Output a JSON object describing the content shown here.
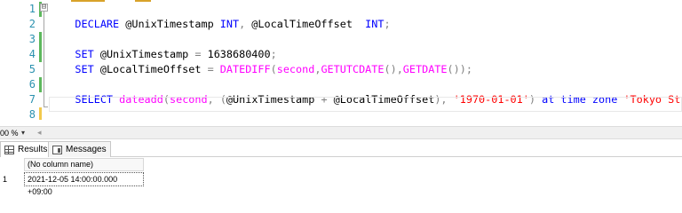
{
  "editor": {
    "line_numbers": [
      "1",
      "2",
      "3",
      "4",
      "5",
      "6",
      "7",
      "8"
    ],
    "fold_symbol": "⊟",
    "lines": {
      "l1": {
        "kw1": "DECLARE",
        "id1": " @UnixTimestamp ",
        "kw2": "INT",
        "op1": ",",
        "id2": " @LocalTimeOffset  ",
        "kw3": "INT",
        "op2": ";"
      },
      "l3": {
        "kw1": "SET",
        "id1": " @UnixTimestamp ",
        "op1": "=",
        "num": " 1638680400",
        "op2": ";"
      },
      "l4": {
        "kw1": "SET",
        "id1": " @LocalTimeOffset ",
        "op1": "=",
        "fn1": " DATEDIFF",
        "op2": "(",
        "kw2": "second",
        "op3": ",",
        "fn2": "GETUTCDATE",
        "op4": "(),",
        "fn3": "GETDATE",
        "op5": "());"
      },
      "l6": {
        "kw1": "SELECT",
        "fn1": " dateadd",
        "op1": "(",
        "kw2": "second",
        "op2": ", (",
        "id1": "@UnixTimestamp ",
        "op3": "+",
        "id2": " @LocalTimeOffset",
        "op4": "), ",
        "str1": "'1970-01-01'",
        "op5": ")",
        "kw3": " at time zone ",
        "str2": "'Tokyo Standard Time'",
        "op6": ";"
      }
    }
  },
  "zoom": {
    "value": "00 %",
    "dropdown_icon": "chevron-down-icon",
    "scroll_left_icon": "◂"
  },
  "tabs": [
    {
      "label": "Results",
      "icon": "grid-icon",
      "active": true
    },
    {
      "label": "Messages",
      "icon": "messages-icon",
      "active": false
    }
  ],
  "results": {
    "columns": [
      "(No column name)"
    ],
    "rows": [
      {
        "num": "1",
        "values": [
          "2021-12-05 14:00:00.000 +09:00"
        ]
      }
    ]
  },
  "colors": {
    "keyword": "#0000ff",
    "function": "#ff00ff",
    "string": "#ff0000",
    "operator": "#808080",
    "line_number": "#2b91af",
    "change_bar": "#5cb85c"
  }
}
